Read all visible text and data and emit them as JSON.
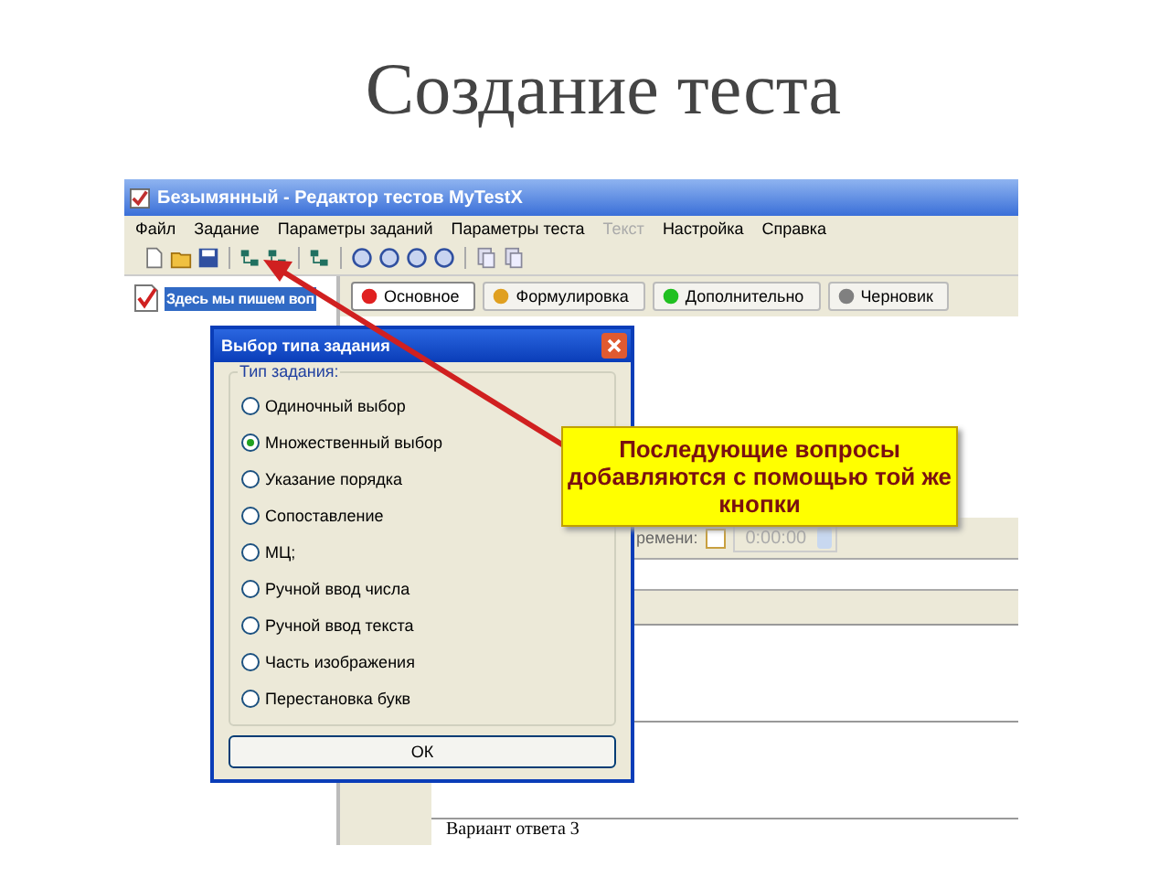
{
  "slide_title": "Создание теста",
  "window": {
    "title": "Безымянный - Редактор тестов MyTestX",
    "menu": [
      {
        "label": "Файл",
        "disabled": false
      },
      {
        "label": "Задание",
        "disabled": false
      },
      {
        "label": "Параметры заданий",
        "disabled": false
      },
      {
        "label": "Параметры теста",
        "disabled": false
      },
      {
        "label": "Текст",
        "disabled": true
      },
      {
        "label": "Настройка",
        "disabled": false
      },
      {
        "label": "Справка",
        "disabled": false
      }
    ],
    "tree_item": {
      "label": "Здесь мы пишем воп",
      "selected": true
    },
    "tabs": [
      {
        "label": "Основное",
        "selected": true,
        "color": "#e02020"
      },
      {
        "label": "Формулировка",
        "selected": false,
        "color": "#e0a020"
      },
      {
        "label": "Дополнительно",
        "selected": false,
        "color": "#20c020"
      },
      {
        "label": "Черновик",
        "selected": false,
        "color": "#808080"
      }
    ],
    "time_label": "ремени:",
    "timer": {
      "checked": false
    },
    "time_value": "0:00:00",
    "answer_label": "Вариант ответа 3"
  },
  "dialog": {
    "title": "Выбор типа задания",
    "group_label": "Тип задания:",
    "options": [
      {
        "label": "Одиночный выбор",
        "selected": false
      },
      {
        "label": "Множественный выбор",
        "selected": true
      },
      {
        "label": "Указание порядка",
        "selected": false
      },
      {
        "label": "Сопоставление",
        "selected": false
      },
      {
        "label": "МЦ;",
        "selected": false
      },
      {
        "label": "Ручной ввод числа",
        "selected": false
      },
      {
        "label": "Ручной ввод текста",
        "selected": false
      },
      {
        "label": "Часть изображения",
        "selected": false
      },
      {
        "label": "Перестановка букв",
        "selected": false
      }
    ],
    "ok_button": "ОК"
  },
  "callout": "Последующие вопросы добавляются с помощью той же кнопки"
}
